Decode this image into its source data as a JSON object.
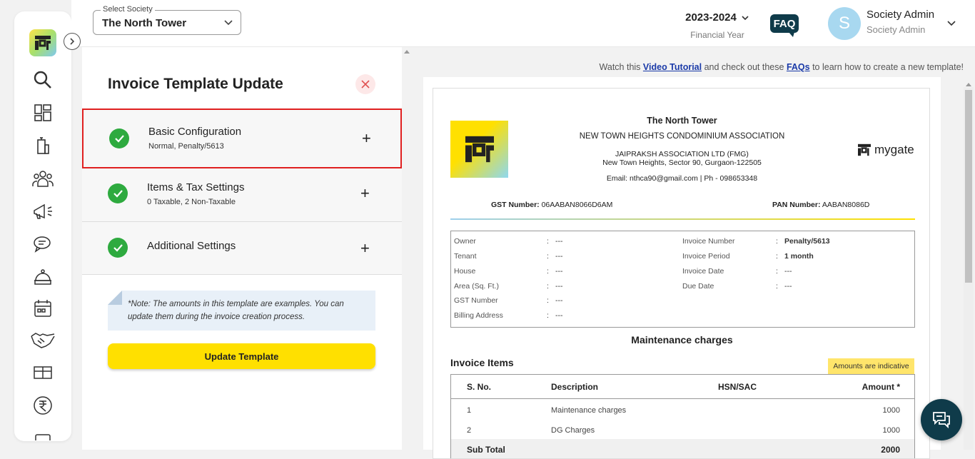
{
  "topbar": {
    "society_label": "Select Society",
    "society_value": "The North Tower",
    "financial_year": "2023-2024",
    "financial_year_label": "Financial Year",
    "faq_label": "FAQ",
    "avatar_initial": "S",
    "user_name": "Society Admin",
    "user_role": "Society Admin"
  },
  "sidebar": {
    "icons": [
      "search-icon",
      "dashboard-icon",
      "building-icon",
      "community-icon",
      "announcement-icon",
      "chat-icon",
      "helpdesk-icon",
      "calendar-icon",
      "handshake-icon",
      "amenities-icon",
      "rupee-icon",
      "more-icon"
    ]
  },
  "panel": {
    "title": "Invoice Template Update",
    "steps": [
      {
        "title": "Basic Configuration",
        "subtitle": "Normal, Penalty/5613"
      },
      {
        "title": "Items & Tax Settings",
        "subtitle": "0 Taxable, 2 Non-Taxable"
      },
      {
        "title": "Additional Settings",
        "subtitle": ""
      }
    ],
    "note": "*Note: The amounts in this template are examples. You can update them during the invoice creation process.",
    "update_button": "Update Template"
  },
  "preview": {
    "watch_prefix": "Watch this ",
    "video_link": "Video Tutorial",
    "watch_middle": " and check out these ",
    "faqs_link": "FAQs",
    "watch_suffix": " to learn how to create a new template!",
    "society_name": "The North Tower",
    "association": "NEW TOWN HEIGHTS CONDOMINIUM ASSOCIATION",
    "company": "JAIPRAKSH ASSOCIATION LTD (FMG)",
    "address": "New Town Heights, Sector 90, Gurgaon-122505",
    "contact": "Email: nthca90@gmail.com | Ph - 098653348",
    "brand": "mygate",
    "gst_label": "GST Number:",
    "gst_value": "06AABAN8066D6AM",
    "pan_label": "PAN Number:",
    "pan_value": "AABAN8086D",
    "left_info": [
      {
        "k": "Owner",
        "v": "---"
      },
      {
        "k": "Tenant",
        "v": "---"
      },
      {
        "k": "House",
        "v": "---"
      },
      {
        "k": "Area (Sq. Ft.)",
        "v": "---"
      },
      {
        "k": "GST Number",
        "v": "---"
      },
      {
        "k": "Billing Address",
        "v": "---"
      }
    ],
    "right_info": [
      {
        "k": "Invoice Number",
        "v": "Penalty/5613"
      },
      {
        "k": "Invoice Period",
        "v": "1 month"
      },
      {
        "k": "Invoice Date",
        "v": "---"
      },
      {
        "k": "Due Date",
        "v": "---"
      }
    ],
    "colon": ":",
    "section_title": "Maintenance charges",
    "items_title": "Invoice Items",
    "indicative_badge": "Amounts are indicative",
    "table": {
      "headers": [
        "S. No.",
        "Description",
        "HSN/SAC",
        "Amount *"
      ],
      "rows": [
        {
          "sno": "1",
          "desc": "Maintenance charges",
          "hsn": "",
          "amount": "1000"
        },
        {
          "sno": "2",
          "desc": "DG Charges",
          "hsn": "",
          "amount": "1000"
        }
      ],
      "subtotal_label": "Sub Total",
      "subtotal_value": "2000"
    }
  }
}
